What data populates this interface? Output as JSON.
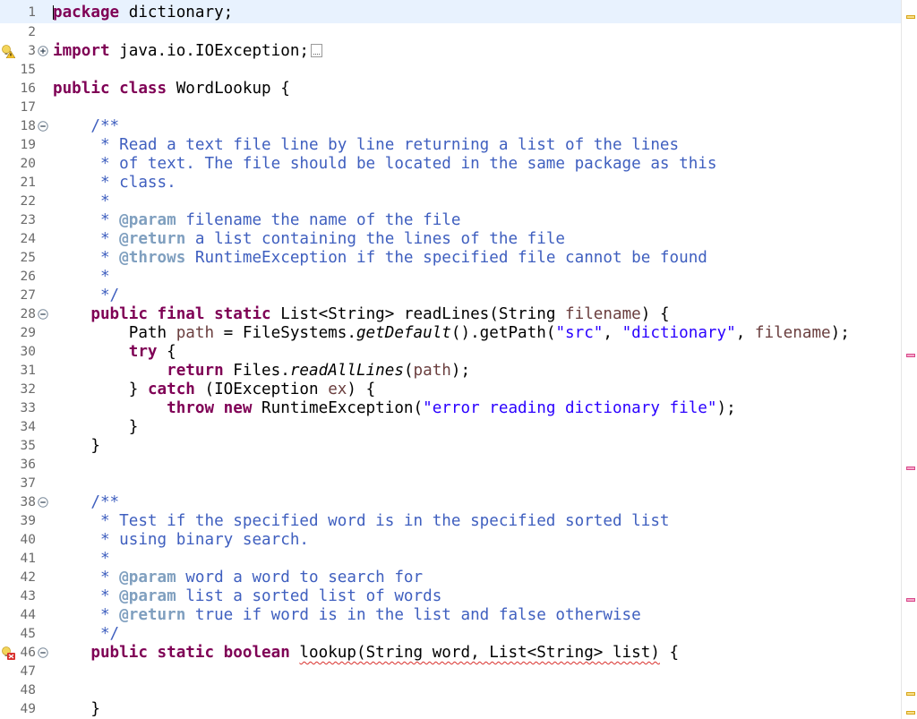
{
  "editor": {
    "lines": [
      {
        "n": "1",
        "fold": "",
        "marker": "",
        "tokens": [
          [
            "kw",
            "package"
          ],
          [
            "p",
            " dictionary;"
          ]
        ]
      },
      {
        "n": "2",
        "fold": "",
        "marker": "",
        "tokens": []
      },
      {
        "n": "3",
        "fold": "plus",
        "marker": "warn",
        "tokens": [
          [
            "kw",
            "import"
          ],
          [
            "p",
            " java.io.IOException;"
          ]
        ],
        "collapsed": true
      },
      {
        "n": "15",
        "fold": "",
        "marker": "",
        "tokens": []
      },
      {
        "n": "16",
        "fold": "",
        "marker": "",
        "tokens": [
          [
            "kw",
            "public class"
          ],
          [
            "p",
            " WordLookup {"
          ]
        ]
      },
      {
        "n": "17",
        "fold": "",
        "marker": "",
        "tokens": []
      },
      {
        "n": "18",
        "fold": "minus",
        "marker": "",
        "tokens": [
          [
            "p",
            "    "
          ],
          [
            "cm",
            "/**"
          ]
        ]
      },
      {
        "n": "19",
        "fold": "",
        "marker": "",
        "tokens": [
          [
            "p",
            "    "
          ],
          [
            "cm",
            " * Read a text file line by line returning a list of the lines"
          ]
        ]
      },
      {
        "n": "20",
        "fold": "",
        "marker": "",
        "tokens": [
          [
            "p",
            "    "
          ],
          [
            "cm",
            " * of text. The file should be located in the same package as this"
          ]
        ]
      },
      {
        "n": "21",
        "fold": "",
        "marker": "",
        "tokens": [
          [
            "p",
            "    "
          ],
          [
            "cm",
            " * class."
          ]
        ]
      },
      {
        "n": "22",
        "fold": "",
        "marker": "",
        "tokens": [
          [
            "p",
            "    "
          ],
          [
            "cm",
            " *"
          ]
        ]
      },
      {
        "n": "23",
        "fold": "",
        "marker": "",
        "tokens": [
          [
            "p",
            "    "
          ],
          [
            "cm",
            " * "
          ],
          [
            "tag",
            "@param"
          ],
          [
            "cm",
            " filename the name of the file"
          ]
        ]
      },
      {
        "n": "24",
        "fold": "",
        "marker": "",
        "tokens": [
          [
            "p",
            "    "
          ],
          [
            "cm",
            " * "
          ],
          [
            "tag",
            "@return"
          ],
          [
            "cm",
            " a list containing the lines of the file"
          ]
        ]
      },
      {
        "n": "25",
        "fold": "",
        "marker": "",
        "tokens": [
          [
            "p",
            "    "
          ],
          [
            "cm",
            " * "
          ],
          [
            "tag",
            "@throws"
          ],
          [
            "cm",
            " RuntimeException if the specified file cannot be found"
          ]
        ]
      },
      {
        "n": "26",
        "fold": "",
        "marker": "",
        "tokens": [
          [
            "p",
            "    "
          ],
          [
            "cm",
            " *"
          ]
        ]
      },
      {
        "n": "27",
        "fold": "",
        "marker": "",
        "tokens": [
          [
            "p",
            "    "
          ],
          [
            "cm",
            " */"
          ]
        ]
      },
      {
        "n": "28",
        "fold": "minus",
        "marker": "",
        "tokens": [
          [
            "p",
            "    "
          ],
          [
            "kw",
            "public final static"
          ],
          [
            "p",
            " List<String> readLines(String "
          ],
          [
            "var",
            "filename"
          ],
          [
            "p",
            ") {"
          ]
        ]
      },
      {
        "n": "29",
        "fold": "",
        "marker": "",
        "tokens": [
          [
            "p",
            "        Path "
          ],
          [
            "var",
            "path"
          ],
          [
            "p",
            " = FileSystems."
          ],
          [
            "it",
            "getDefault"
          ],
          [
            "p",
            "().getPath("
          ],
          [
            "str",
            "\"src\""
          ],
          [
            "p",
            ", "
          ],
          [
            "str",
            "\"dictionary\""
          ],
          [
            "p",
            ", "
          ],
          [
            "var",
            "filename"
          ],
          [
            "p",
            ");"
          ]
        ]
      },
      {
        "n": "30",
        "fold": "",
        "marker": "",
        "tokens": [
          [
            "p",
            "        "
          ],
          [
            "kw",
            "try"
          ],
          [
            "p",
            " {"
          ]
        ]
      },
      {
        "n": "31",
        "fold": "",
        "marker": "",
        "tokens": [
          [
            "p",
            "            "
          ],
          [
            "kw",
            "return"
          ],
          [
            "p",
            " Files."
          ],
          [
            "it",
            "readAllLines"
          ],
          [
            "p",
            "("
          ],
          [
            "var",
            "path"
          ],
          [
            "p",
            ");"
          ]
        ]
      },
      {
        "n": "32",
        "fold": "",
        "marker": "",
        "tokens": [
          [
            "p",
            "        } "
          ],
          [
            "kw",
            "catch"
          ],
          [
            "p",
            " (IOException "
          ],
          [
            "var",
            "ex"
          ],
          [
            "p",
            ") {"
          ]
        ]
      },
      {
        "n": "33",
        "fold": "",
        "marker": "",
        "tokens": [
          [
            "p",
            "            "
          ],
          [
            "kw",
            "throw new"
          ],
          [
            "p",
            " RuntimeException("
          ],
          [
            "str",
            "\"error reading dictionary file\""
          ],
          [
            "p",
            ");"
          ]
        ]
      },
      {
        "n": "34",
        "fold": "",
        "marker": "",
        "tokens": [
          [
            "p",
            "        }"
          ]
        ]
      },
      {
        "n": "35",
        "fold": "",
        "marker": "",
        "tokens": [
          [
            "p",
            "    }"
          ]
        ]
      },
      {
        "n": "36",
        "fold": "",
        "marker": "",
        "tokens": []
      },
      {
        "n": "37",
        "fold": "",
        "marker": "",
        "tokens": []
      },
      {
        "n": "38",
        "fold": "minus",
        "marker": "",
        "tokens": [
          [
            "p",
            "    "
          ],
          [
            "cm",
            "/**"
          ]
        ]
      },
      {
        "n": "39",
        "fold": "",
        "marker": "",
        "tokens": [
          [
            "p",
            "    "
          ],
          [
            "cm",
            " * Test if the specified word is in the specified sorted list"
          ]
        ]
      },
      {
        "n": "40",
        "fold": "",
        "marker": "",
        "tokens": [
          [
            "p",
            "    "
          ],
          [
            "cm",
            " * using binary search."
          ]
        ]
      },
      {
        "n": "41",
        "fold": "",
        "marker": "",
        "tokens": [
          [
            "p",
            "    "
          ],
          [
            "cm",
            " *"
          ]
        ]
      },
      {
        "n": "42",
        "fold": "",
        "marker": "",
        "tokens": [
          [
            "p",
            "    "
          ],
          [
            "cm",
            " * "
          ],
          [
            "tag",
            "@param"
          ],
          [
            "cm",
            " word a word to search for"
          ]
        ]
      },
      {
        "n": "43",
        "fold": "",
        "marker": "",
        "tokens": [
          [
            "p",
            "    "
          ],
          [
            "cm",
            " * "
          ],
          [
            "tag",
            "@param"
          ],
          [
            "cm",
            " list a sorted list of words"
          ]
        ]
      },
      {
        "n": "44",
        "fold": "",
        "marker": "",
        "tokens": [
          [
            "p",
            "    "
          ],
          [
            "cm",
            " * "
          ],
          [
            "tag",
            "@return"
          ],
          [
            "cm",
            " true if word is in the list and false otherwise"
          ]
        ]
      },
      {
        "n": "45",
        "fold": "",
        "marker": "",
        "tokens": [
          [
            "p",
            "    "
          ],
          [
            "cm",
            " */"
          ]
        ]
      },
      {
        "n": "46",
        "fold": "minus",
        "marker": "error",
        "tokens": [
          [
            "p",
            "    "
          ],
          [
            "kw",
            "public static boolean"
          ],
          [
            "p",
            " "
          ],
          [
            "err",
            "lookup(String word, List<String> list)"
          ],
          [
            "p",
            " {"
          ]
        ]
      },
      {
        "n": "47",
        "fold": "",
        "marker": "",
        "tokens": []
      },
      {
        "n": "48",
        "fold": "",
        "marker": "",
        "tokens": []
      },
      {
        "n": "49",
        "fold": "",
        "marker": "",
        "tokens": [
          [
            "p",
            "    }"
          ]
        ]
      }
    ]
  },
  "overview_ruler": {
    "marks": [
      {
        "kind": "warn",
        "line": "1"
      },
      {
        "kind": "err",
        "line": "30"
      },
      {
        "kind": "err",
        "line": "36"
      },
      {
        "kind": "err",
        "line": "43"
      },
      {
        "kind": "warn",
        "line": "48"
      },
      {
        "kind": "warn",
        "line": "49"
      }
    ]
  },
  "icons": {
    "fold_expand": "plus-circle-icon",
    "fold_collapse": "minus-circle-icon",
    "warning": "lightbulb-warning-icon",
    "error": "lightbulb-error-icon"
  },
  "colors": {
    "keyword": "#7f0055",
    "comment": "#3f5fbf",
    "javadoc_tag": "#7f9fbf",
    "string": "#2a00ff",
    "variable": "#6a3e3e",
    "current_line": "#e8f2fe"
  }
}
